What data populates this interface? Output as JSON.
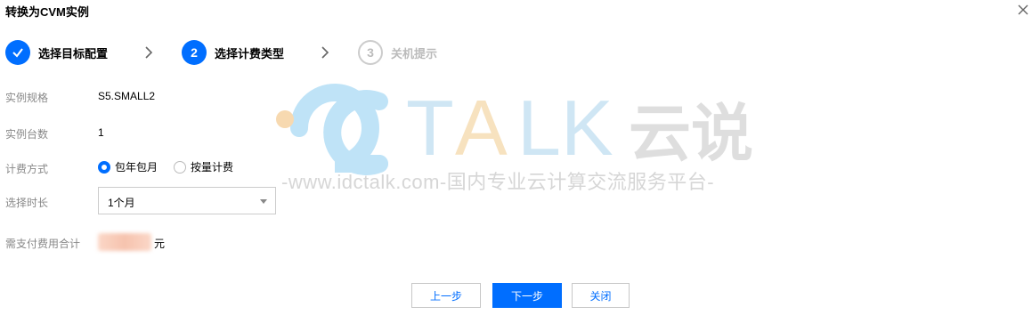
{
  "dialog": {
    "title": "转换为CVM实例"
  },
  "steps": [
    {
      "number": "✓",
      "label": "选择目标配置",
      "state": "done"
    },
    {
      "number": "2",
      "label": "选择计费类型",
      "state": "active"
    },
    {
      "number": "3",
      "label": "关机提示",
      "state": "pending"
    }
  ],
  "watermark": {
    "brand": "TALK",
    "brand_cn": "云说",
    "url": "-www.idctalk.com-国内专业云计算交流服务平台-"
  },
  "form": {
    "spec_label": "实例规格",
    "spec_value": "S5.SMALL2",
    "count_label": "实例台数",
    "count_value": "1",
    "billing_label": "计费方式",
    "billing_options": [
      {
        "label": "包年包月",
        "checked": true
      },
      {
        "label": "按量计费",
        "checked": false
      }
    ],
    "duration_label": "选择时长",
    "duration_value": "1个月",
    "total_label": "需支付费用合计",
    "total_unit": "元"
  },
  "buttons": {
    "prev": "上一步",
    "next": "下一步",
    "close": "关闭"
  },
  "colors": {
    "accent": "#006eff",
    "pending": "#bbbbbb",
    "label": "#888888"
  }
}
